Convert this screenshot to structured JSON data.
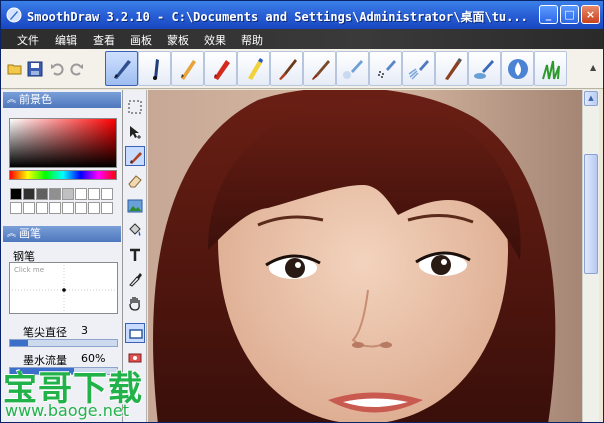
{
  "window": {
    "title": "SmoothDraw 3.2.10 - C:\\Documents and Settings\\Administrator\\桌面\\tu...",
    "minimize": "_",
    "maximize": "□",
    "close": "×"
  },
  "menu": {
    "items": [
      "文件",
      "编辑",
      "查看",
      "画板",
      "蒙板",
      "效果",
      "帮助"
    ]
  },
  "toolbar": {
    "brushes": [
      "pen-icon",
      "ink-pen-icon",
      "pencil-icon",
      "crayon-icon",
      "marker-icon",
      "flat-brush-icon",
      "round-brush-icon",
      "airbrush-icon",
      "spray-icon",
      "splatter-icon",
      "dry-brush-icon",
      "water-brush-icon",
      "blur-icon",
      "grass-icon"
    ],
    "scroll": "▲"
  },
  "foreground": {
    "title": "前景色",
    "hue_strip": "#ff0000"
  },
  "brush_panel": {
    "title": "画笔",
    "brush_name": "钢笔",
    "click_hint": "Click me",
    "tip_diameter_label": "笔尖直径",
    "tip_diameter_value": "3",
    "ink_flow_label": "墨水流量",
    "ink_flow_value": "60%",
    "ink_flow_level": 0.6
  },
  "watermark": {
    "text": "宝哥下载",
    "url": "www.baoge.net"
  },
  "colors": {
    "title_bar": "#2a62d8",
    "menu_bar": "#2e2e2e",
    "panel_header": "#5a80c4",
    "watermark": "#22b24a"
  }
}
